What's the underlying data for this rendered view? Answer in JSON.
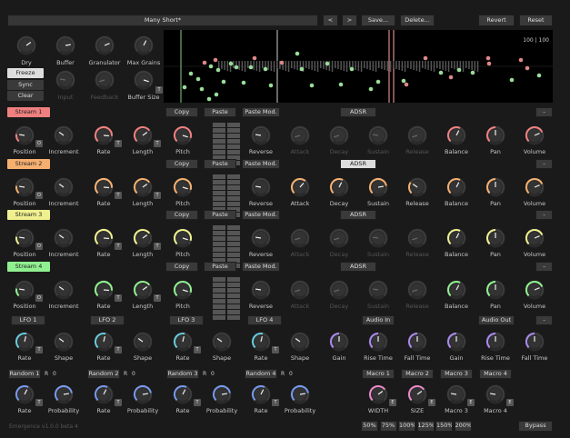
{
  "top": {
    "preset": "Many Short*",
    "prev": "<",
    "next": ">",
    "save": "Save...",
    "delete": "Delete...",
    "revert": "Revert",
    "reset": "Reset"
  },
  "global": {
    "dry": "Dry",
    "buffer": "Buffer",
    "granulator": "Granulator",
    "max_grains": "Max Grains",
    "freeze": "Freeze",
    "sync": "Sync",
    "clear": "Clear",
    "input": "Input",
    "feedback": "Feedback",
    "buffer_size": "Buffer Size"
  },
  "display": {
    "readout": "100 | 100"
  },
  "streams": [
    {
      "name": "Stream 1",
      "color": "#f08080"
    },
    {
      "name": "Stream 2",
      "color": "#f5b070"
    },
    {
      "name": "Stream 3",
      "color": "#f0f090"
    },
    {
      "name": "Stream 4",
      "color": "#90f090"
    }
  ],
  "stream_controls": {
    "copy": "Copy",
    "paste": "Paste",
    "paste_mod": "Paste Mod.",
    "adsr": "ADSR",
    "minus": "-",
    "position": "Position",
    "increment": "Increment",
    "rate": "Rate",
    "length": "Length",
    "pitch": "Pitch",
    "reverse": "Reverse",
    "attack": "Attack",
    "decay": "Decay",
    "sustain": "Sustain",
    "release": "Release",
    "balance": "Balance",
    "pan": "Pan",
    "volume": "Volume",
    "t": "T",
    "o": "O"
  },
  "lfos": [
    "LFO 1",
    "LFO 2",
    "LFO 3",
    "LFO 4"
  ],
  "lfo_controls": {
    "rate": "Rate",
    "shape": "Shape"
  },
  "randoms": [
    "Random 1",
    "Random 2",
    "Random 3",
    "Random 4"
  ],
  "random_controls": {
    "rate": "Rate",
    "probability": "Probability",
    "r": "R",
    "zero": "0"
  },
  "audio_in": {
    "label": "Audio In",
    "gain": "Gain",
    "rise": "Rise Time",
    "fall": "Fall Time"
  },
  "audio_out": {
    "label": "Audio Out",
    "gain": "Gain",
    "rise": "Rise Time",
    "fall": "Fall Time",
    "minus": "-"
  },
  "macros": {
    "labels": [
      "Macro 1",
      "Macro 2",
      "Macro 3",
      "Macro 4"
    ],
    "knobs": [
      "WIDTH",
      "SIZE",
      "Macro 3",
      "Macro 4"
    ],
    "e": "E"
  },
  "zoom": [
    "50%",
    "75%",
    "100%",
    "125%",
    "150%",
    "200%"
  ],
  "bypass": "Bypass",
  "version": "Emergence v1.0.0 beta 4"
}
